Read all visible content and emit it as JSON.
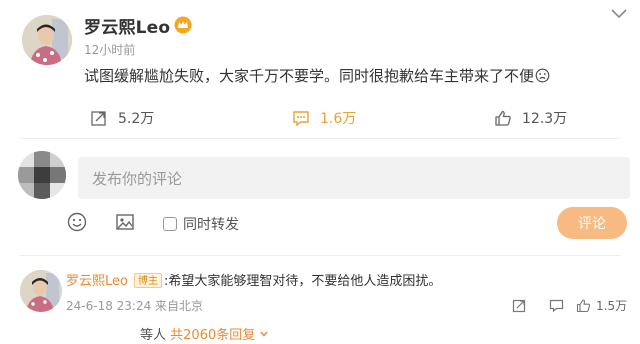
{
  "post": {
    "author": "罗云熙Leo",
    "time": "12小时前",
    "text": "试图缓解尴尬失败，大家千万不要学。同时很抱歉给车主带来了不便",
    "actions": {
      "repost": "5.2万",
      "comment": "1.6万",
      "like": "12.3万"
    }
  },
  "composer": {
    "placeholder": "发布你的评论",
    "repost_label": "同时转发",
    "submit_label": "评论"
  },
  "reply": {
    "author": "罗云熙Leo",
    "badge": "博主",
    "text": ":希望大家能够理智对待，不要给他人造成困扰。",
    "meta": "24-6-18 23:24 来自北京",
    "likes": "1.5万",
    "sub_prefix": "等人",
    "sub_count": "共2060条回复"
  },
  "colors": {
    "accent": "#ec8a34",
    "submit_bg": "#f7ba82",
    "input_bg": "#f2f2f2"
  }
}
